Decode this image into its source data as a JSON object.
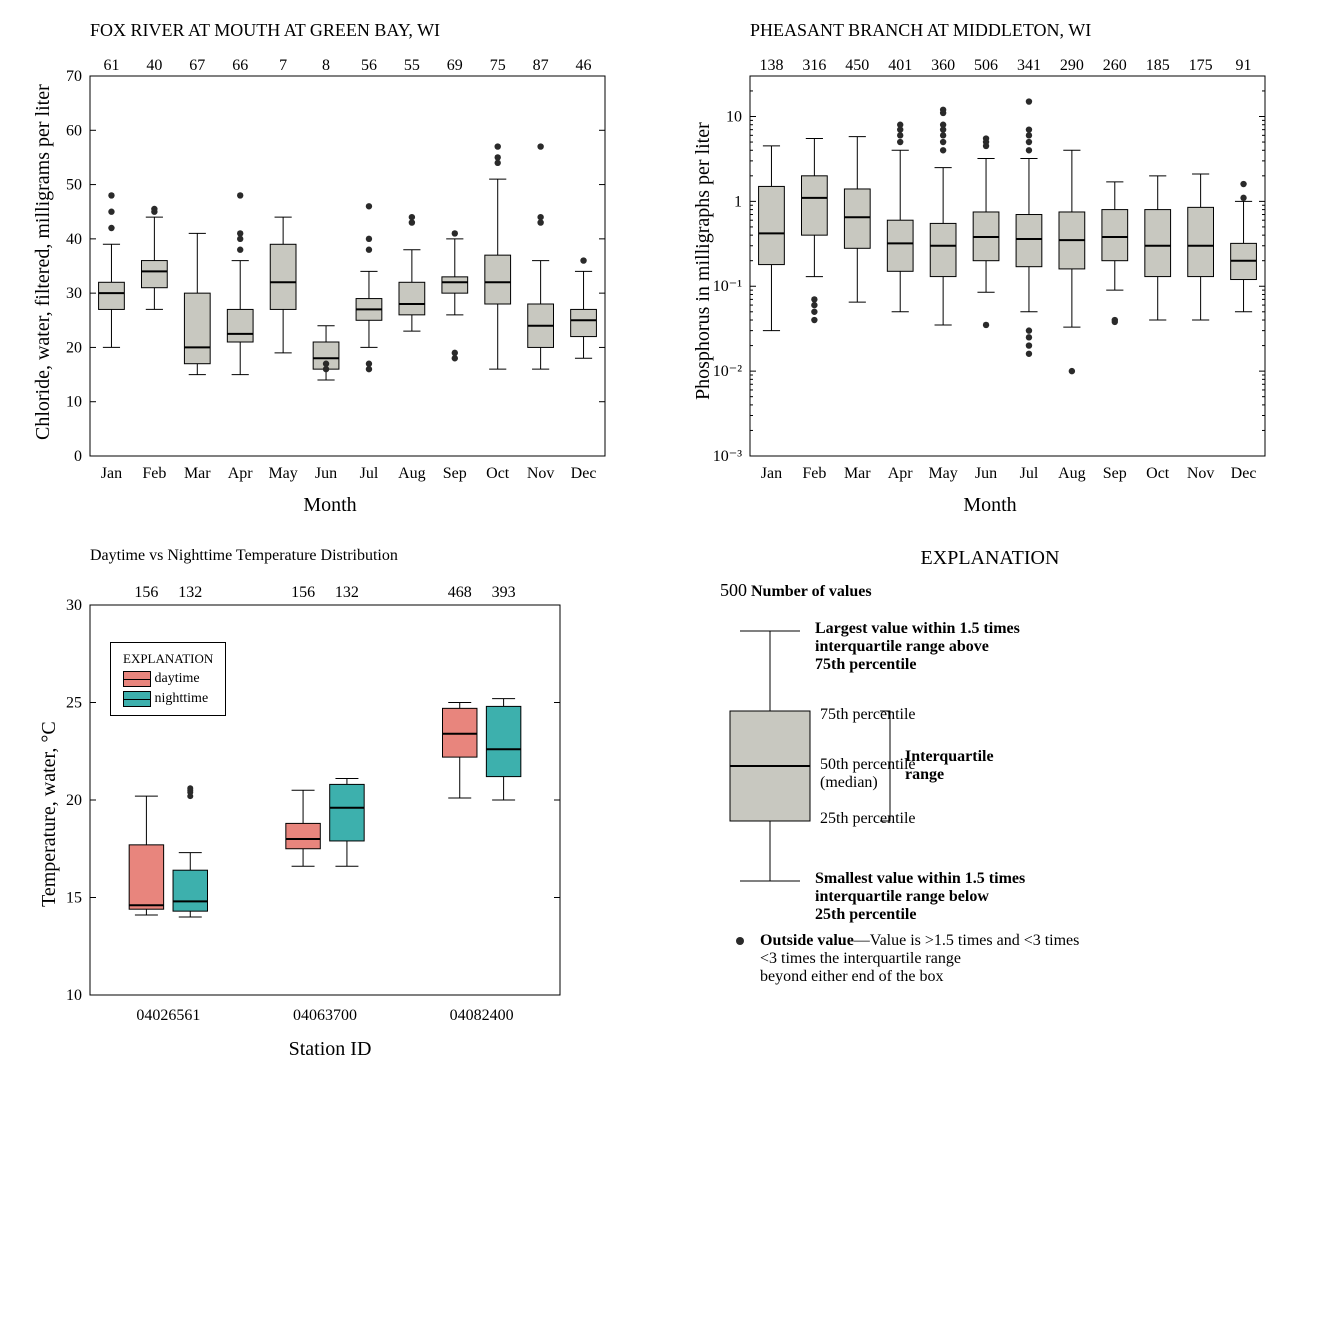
{
  "chart_data": [
    {
      "type": "boxplot",
      "title": "FOX RIVER AT MOUTH AT GREEN BAY, WI",
      "xlabel": "Month",
      "ylabel": "Chloride, water, filtered, milligrams per liter",
      "ylim": [
        0,
        70
      ],
      "yticks": [
        0,
        10,
        20,
        30,
        40,
        50,
        60,
        70
      ],
      "categories": [
        "Jan",
        "Feb",
        "Mar",
        "Apr",
        "May",
        "Jun",
        "Jul",
        "Aug",
        "Sep",
        "Oct",
        "Nov",
        "Dec"
      ],
      "counts": [
        61,
        40,
        67,
        66,
        7,
        8,
        56,
        55,
        69,
        75,
        87,
        46
      ],
      "boxes": [
        {
          "min": 20,
          "q1": 27,
          "med": 30,
          "q3": 32,
          "max": 39,
          "out": [
            42,
            45,
            48
          ]
        },
        {
          "min": 27,
          "q1": 31,
          "med": 34,
          "q3": 36,
          "max": 44,
          "out": [
            45.5,
            45
          ]
        },
        {
          "min": 15,
          "q1": 17,
          "med": 20,
          "q3": 30,
          "max": 41,
          "out": []
        },
        {
          "min": 15,
          "q1": 21,
          "med": 22.5,
          "q3": 27,
          "max": 36,
          "out": [
            38,
            40,
            41,
            48
          ]
        },
        {
          "min": 19,
          "q1": 27,
          "med": 32,
          "q3": 39,
          "max": 44,
          "out": []
        },
        {
          "min": 14,
          "q1": 16,
          "med": 18,
          "q3": 21,
          "max": 24,
          "out": [
            16,
            17
          ]
        },
        {
          "min": 20,
          "q1": 25,
          "med": 27,
          "q3": 29,
          "max": 34,
          "out": [
            16,
            17,
            38,
            40,
            46
          ]
        },
        {
          "min": 23,
          "q1": 26,
          "med": 28,
          "q3": 32,
          "max": 38,
          "out": [
            43,
            44
          ]
        },
        {
          "min": 26,
          "q1": 30,
          "med": 32,
          "q3": 33,
          "max": 40,
          "out": [
            18,
            19,
            41
          ]
        },
        {
          "min": 16,
          "q1": 28,
          "med": 32,
          "q3": 37,
          "max": 51,
          "out": [
            54,
            55,
            57
          ]
        },
        {
          "min": 16,
          "q1": 20,
          "med": 24,
          "q3": 28,
          "max": 36,
          "out": [
            43,
            44,
            57
          ]
        },
        {
          "min": 18,
          "q1": 22,
          "med": 25,
          "q3": 27,
          "max": 34,
          "out": [
            36
          ]
        }
      ]
    },
    {
      "type": "boxplot",
      "title": "PHEASANT BRANCH AT MIDDLETON, WI",
      "xlabel": "Month",
      "ylabel": "Phosphorus in milligraphs per liter",
      "yscale": "log",
      "ylim": [
        0.001,
        30
      ],
      "yticks": [
        0.001,
        0.01,
        0.1,
        1,
        10
      ],
      "yticklabels": [
        "10⁻³",
        "10⁻²",
        "10⁻¹",
        "1",
        "10"
      ],
      "categories": [
        "Jan",
        "Feb",
        "Mar",
        "Apr",
        "May",
        "Jun",
        "Jul",
        "Aug",
        "Sep",
        "Oct",
        "Nov",
        "Dec"
      ],
      "counts": [
        138,
        316,
        450,
        401,
        360,
        506,
        341,
        290,
        260,
        185,
        175,
        91
      ],
      "boxes": [
        {
          "min": 0.03,
          "q1": 0.18,
          "med": 0.42,
          "q3": 1.5,
          "max": 4.5,
          "out": []
        },
        {
          "min": 0.13,
          "q1": 0.4,
          "med": 1.1,
          "q3": 2.0,
          "max": 5.5,
          "out": [
            0.04,
            0.05,
            0.06,
            0.07
          ]
        },
        {
          "min": 0.065,
          "q1": 0.28,
          "med": 0.65,
          "q3": 1.4,
          "max": 5.8,
          "out": []
        },
        {
          "min": 0.05,
          "q1": 0.15,
          "med": 0.32,
          "q3": 0.6,
          "max": 4.0,
          "out": [
            5,
            6,
            7,
            8
          ]
        },
        {
          "min": 0.035,
          "q1": 0.13,
          "med": 0.3,
          "q3": 0.55,
          "max": 2.5,
          "out": [
            4,
            5,
            6,
            7,
            8,
            11,
            12
          ]
        },
        {
          "min": 0.085,
          "q1": 0.2,
          "med": 0.38,
          "q3": 0.75,
          "max": 3.2,
          "out": [
            0.035,
            4.5,
            5,
            5.5
          ]
        },
        {
          "min": 0.05,
          "q1": 0.17,
          "med": 0.36,
          "q3": 0.7,
          "max": 3.2,
          "out": [
            0.016,
            0.02,
            0.025,
            0.03,
            4,
            5,
            6,
            7,
            15
          ]
        },
        {
          "min": 0.033,
          "q1": 0.16,
          "med": 0.35,
          "q3": 0.75,
          "max": 4.0,
          "out": [
            0.01
          ]
        },
        {
          "min": 0.09,
          "q1": 0.2,
          "med": 0.38,
          "q3": 0.8,
          "max": 1.7,
          "out": [
            0.038,
            0.04
          ]
        },
        {
          "min": 0.04,
          "q1": 0.13,
          "med": 0.3,
          "q3": 0.8,
          "max": 2.0,
          "out": []
        },
        {
          "min": 0.04,
          "q1": 0.13,
          "med": 0.3,
          "q3": 0.85,
          "max": 2.1,
          "out": []
        },
        {
          "min": 0.05,
          "q1": 0.12,
          "med": 0.2,
          "q3": 0.32,
          "max": 1.0,
          "out": [
            1.1,
            1.6
          ]
        }
      ]
    },
    {
      "type": "grouped_boxplot",
      "title": "Daytime vs Nighttime Temperature Distribution",
      "xlabel": "Station ID",
      "ylabel": "Temperature, water, °C",
      "ylim": [
        10,
        30
      ],
      "yticks": [
        10,
        15,
        20,
        25,
        30
      ],
      "categories": [
        "04026561",
        "04063700",
        "04082400"
      ],
      "series": [
        {
          "name": "daytime",
          "color": "#e8857d",
          "counts": [
            156,
            156,
            468
          ],
          "boxes": [
            {
              "min": 14.1,
              "q1": 14.4,
              "med": 14.6,
              "q3": 17.7,
              "max": 20.2,
              "out": []
            },
            {
              "min": 16.6,
              "q1": 17.5,
              "med": 18.0,
              "q3": 18.8,
              "max": 20.5,
              "out": []
            },
            {
              "min": 20.1,
              "q1": 22.2,
              "med": 23.4,
              "q3": 24.7,
              "max": 25.0,
              "out": []
            }
          ]
        },
        {
          "name": "nighttime",
          "color": "#3db0ad",
          "counts": [
            132,
            132,
            393
          ],
          "boxes": [
            {
              "min": 14.0,
              "q1": 14.3,
              "med": 14.8,
              "q3": 16.4,
              "max": 17.3,
              "out": [
                20.2,
                20.4,
                20.5,
                20.6
              ]
            },
            {
              "min": 16.6,
              "q1": 17.9,
              "med": 19.6,
              "q3": 20.8,
              "max": 21.1,
              "out": []
            },
            {
              "min": 20.0,
              "q1": 21.2,
              "med": 22.6,
              "q3": 24.8,
              "max": 25.2,
              "out": []
            }
          ]
        }
      ]
    }
  ],
  "explanation": {
    "heading": "EXPLANATION",
    "count_sample": "500",
    "count_label": "Number of values",
    "upper_whisker": "Largest value within 1.5 times interquartile range above 75th percentile",
    "p75": "75th percentile",
    "p50": "50th percentile (median)",
    "p25": "25th percentile",
    "iqr": "Interquartile range",
    "lower_whisker": "Smallest value within 1.5 times interquartile range below 25th percentile",
    "outlier_label": "Outside value",
    "outlier_desc": "—Value is >1.5 times and <3 times the interquartile range beyond either end of the box"
  },
  "legend3": {
    "title": "EXPLANATION",
    "items": [
      "daytime",
      "nighttime"
    ]
  }
}
